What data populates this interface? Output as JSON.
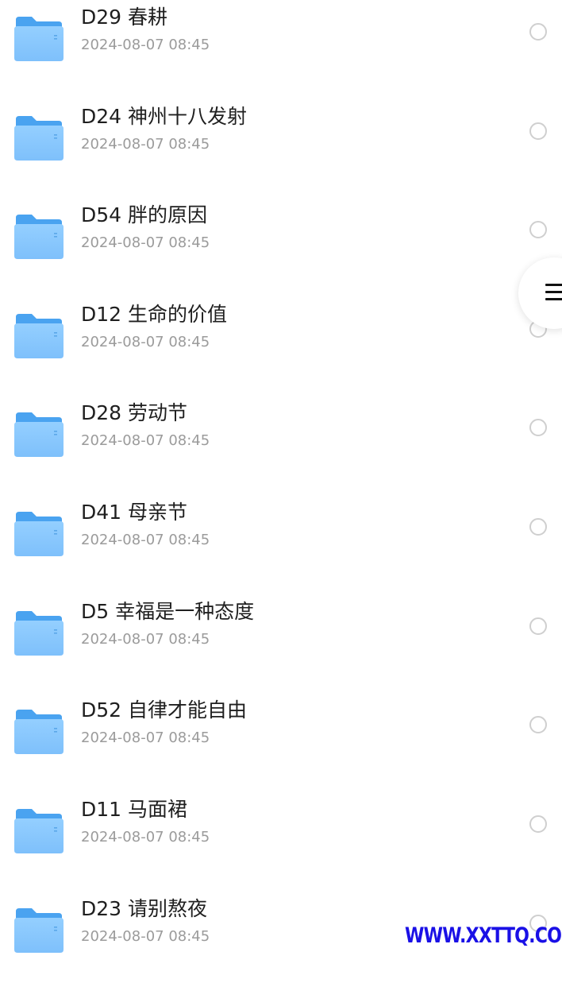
{
  "items": [
    {
      "title": "D29 春耕",
      "date": "2024-08-07 08:45"
    },
    {
      "title": "D24 神州十八发射",
      "date": "2024-08-07 08:45"
    },
    {
      "title": "D54 胖的原因",
      "date": "2024-08-07 08:45"
    },
    {
      "title": "D12 生命的价值",
      "date": "2024-08-07 08:45"
    },
    {
      "title": "D28 劳动节",
      "date": "2024-08-07 08:45"
    },
    {
      "title": "D41 母亲节",
      "date": "2024-08-07 08:45"
    },
    {
      "title": "D5 幸福是一种态度",
      "date": "2024-08-07 08:45"
    },
    {
      "title": "D52 自律才能自由",
      "date": "2024-08-07 08:45"
    },
    {
      "title": "D11 马面裙",
      "date": "2024-08-07 08:45"
    },
    {
      "title": "D23 请别熬夜",
      "date": "2024-08-07 08:45"
    }
  ],
  "icons": {
    "item": "folder-icon",
    "select": "radio-circle-icon",
    "floating": "menu-icon"
  },
  "colors": {
    "folder_back": "#4aa3f0",
    "folder_front": "#8ecbff",
    "title": "#1f1f1f",
    "date": "#9b9b9b",
    "watermark": "#1a10e6"
  },
  "watermark": "WWW.XXTTQ.COM"
}
